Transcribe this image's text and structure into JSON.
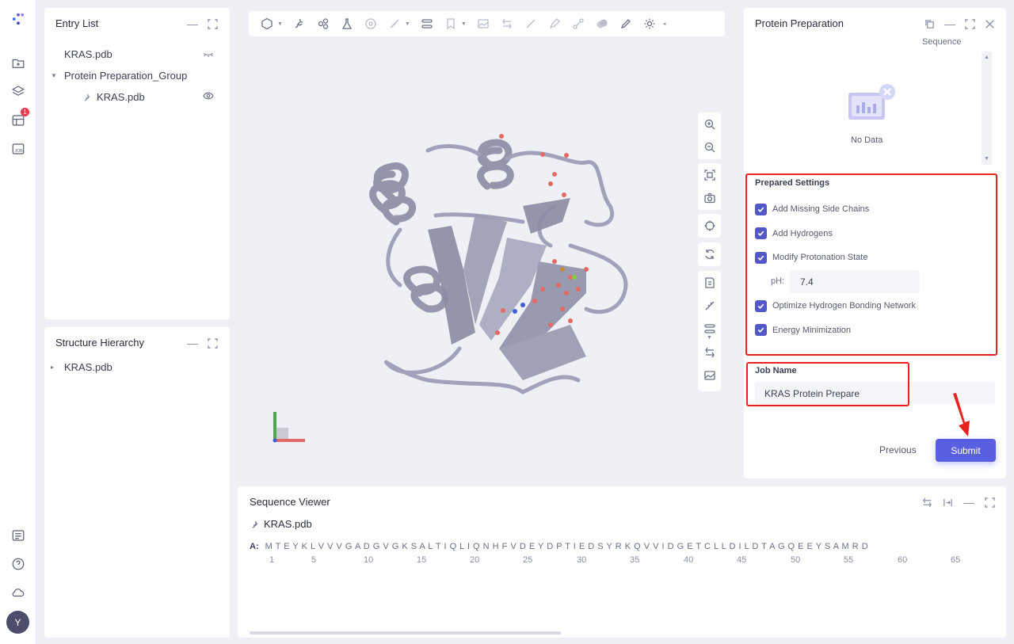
{
  "rail": {
    "badge_count": "1",
    "avatar_initial": "Y"
  },
  "entry_list": {
    "title": "Entry List",
    "items": [
      {
        "label": "KRAS.pdb"
      },
      {
        "label": "Protein Preparation_Group"
      },
      {
        "label": "KRAS.pdb"
      }
    ]
  },
  "structure_hierarchy": {
    "title": "Structure Hierarchy",
    "items": [
      {
        "label": "KRAS.pdb"
      }
    ]
  },
  "protein_preparation": {
    "title": "Protein Preparation",
    "sequence_label": "Sequence",
    "empty_text": "No Data",
    "settings_title": "Prepared Settings",
    "options": [
      {
        "label": "Add Missing Side Chains",
        "checked": true
      },
      {
        "label": "Add Hydrogens",
        "checked": true
      },
      {
        "label": "Modify Protonation State",
        "checked": true
      },
      {
        "label": "Optimize Hydrogen Bonding Network",
        "checked": true
      },
      {
        "label": "Energy Minimization",
        "checked": true
      }
    ],
    "ph_label": "pH:",
    "ph_value": "7.4",
    "job_name_label": "Job Name",
    "job_name_value": "KRAS Protein Prepare",
    "previous_label": "Previous",
    "submit_label": "Submit"
  },
  "sequence_viewer": {
    "title": "Sequence Viewer",
    "file": "KRAS.pdb",
    "chain": "A:",
    "sequence": "M T E Y K L V V V G A D G V G K S A L T I Q L I Q N H F V D E Y D P T I E D S Y R K Q V V I D G E T C L L D I L D T A G Q E E Y S A M R D",
    "positions": [
      "1",
      "5",
      "10",
      "15",
      "20",
      "25",
      "30",
      "35",
      "40",
      "45",
      "50",
      "55",
      "60",
      "65"
    ]
  },
  "colors": {
    "accent": "#5a5ee0",
    "highlight": "#e8231e",
    "protein": "#8f92a8"
  }
}
